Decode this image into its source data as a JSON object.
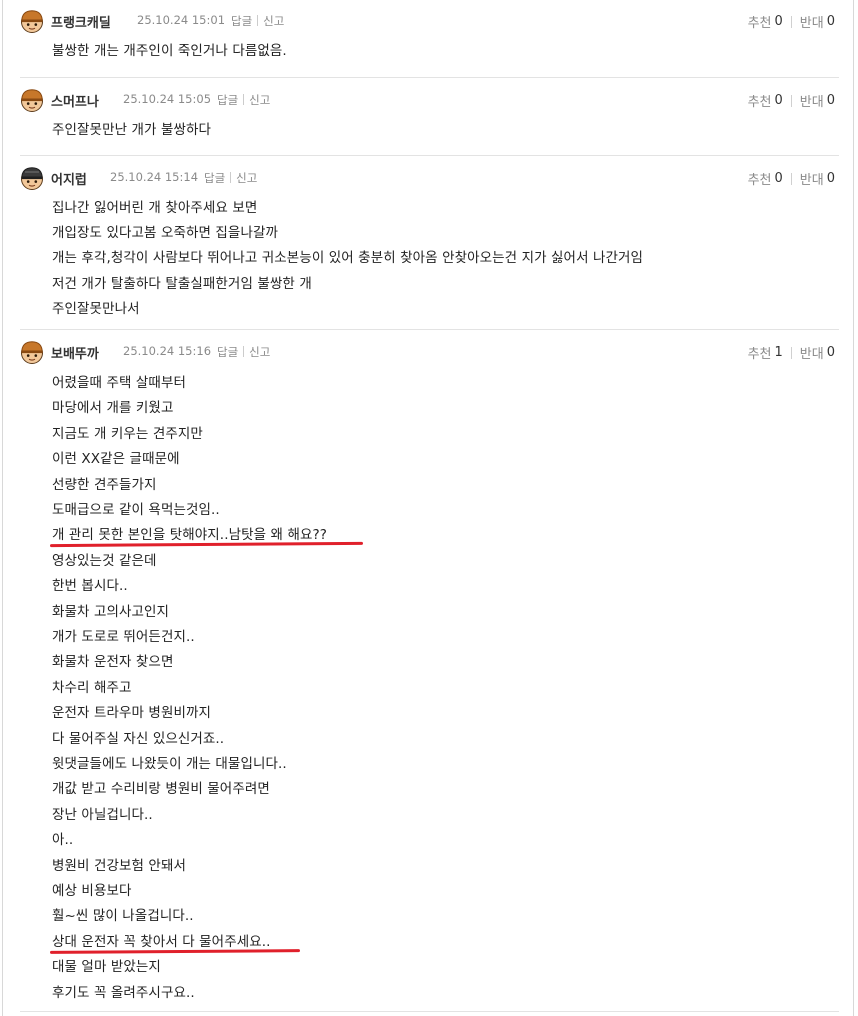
{
  "actions": {
    "reply_label": "답글",
    "report_label": "신고",
    "recommend_label": "추천",
    "oppose_label": "반대"
  },
  "comments": [
    {
      "nickname": "프랭크캐딜",
      "datetime": "25.10.24 15:01",
      "recommend_count": "0",
      "oppose_count": "0",
      "avatar": "avatar-helmet-icon",
      "lines": [
        "불쌍한 개는 개주인이 죽인거나 다름없음."
      ]
    },
    {
      "nickname": "스머프나",
      "datetime": "25.10.24 15:05",
      "recommend_count": "0",
      "oppose_count": "0",
      "avatar": "avatar-helmet-icon",
      "lines": [
        "주인잘못만난 개가 불쌍하다"
      ]
    },
    {
      "nickname": "어지럽",
      "datetime": "25.10.24 15:14",
      "recommend_count": "0",
      "oppose_count": "0",
      "avatar": "avatar-dark-helmet-icon",
      "lines": [
        "집나간 잃어버린 개 찾아주세요 보면",
        "개입장도 있다고봄 오죽하면 집을나갈까",
        "개는 후각,청각이 사람보다 뛰어나고 귀소본능이 있어 충분히 찾아옴 안찾아오는건 지가 싫어서 나간거임",
        "저건 개가 탈출하다 탈출실패한거임 불쌍한 개",
        "주인잘못만나서"
      ]
    },
    {
      "nickname": "보배뚜까",
      "datetime": "25.10.24 15:16",
      "recommend_count": "1",
      "oppose_count": "0",
      "avatar": "avatar-helmet-icon",
      "lines": [
        "어렸을때 주택 살때부터",
        "마당에서 개를 키웠고",
        "지금도 개 키우는 견주지만",
        "이런 XX같은 글때문에",
        "선량한 견주들가지",
        "도매급으로 같이 욕먹는것임..",
        "개 관리 못한 본인을 탓해야지..남탓을 왜 해요??",
        "영상있는것 같은데",
        "한번 봅시다..",
        "화물차 고의사고인지",
        "개가 도로로 뛰어든건지..",
        "화물차 운전자 찾으면",
        "차수리 해주고",
        "운전자 트라우마 병원비까지",
        "다 물어주실 자신 있으신거죠..",
        "윗댓글들에도 나왔듯이 개는 대물입니다..",
        "개값 받고 수리비랑 병원비 물어주려면",
        "장난 아닐겁니다..",
        "아..",
        "병원비 건강보험 안돼서",
        "예상 비용보다",
        "훨~씬 많이 나올겁니다..",
        "상대 운전자 꼭 찾아서 다 물어주세요..",
        "대물 얼마 받았는지",
        "후기도 꼭 올려주시구요.."
      ]
    }
  ],
  "colors": {
    "underline": "#e0202b",
    "nickname": "#333333",
    "meta": "#8a8a8a",
    "divider": "#e3e3e3"
  }
}
